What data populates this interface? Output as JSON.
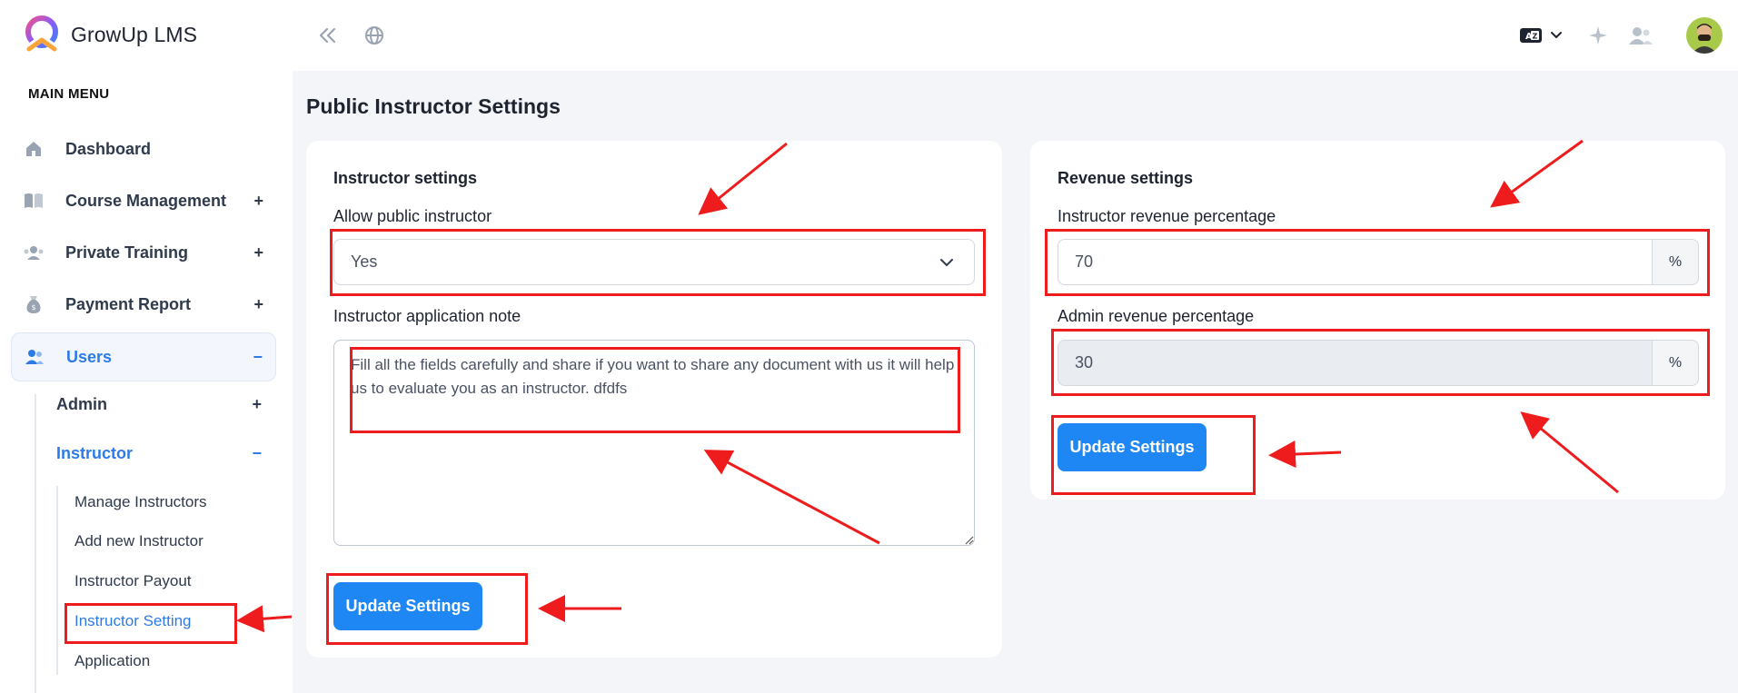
{
  "brand": {
    "name": "GrowUp LMS"
  },
  "sidebar": {
    "heading": "MAIN MENU",
    "items": [
      {
        "label": "Dashboard",
        "icon": "home-icon",
        "toggle": ""
      },
      {
        "label": "Course Management",
        "icon": "book-icon",
        "toggle": "+"
      },
      {
        "label": "Private Training",
        "icon": "training-icon",
        "toggle": "+"
      },
      {
        "label": "Payment Report",
        "icon": "money-bag-icon",
        "toggle": "+"
      },
      {
        "label": "Users",
        "icon": "users-icon",
        "toggle": "−"
      }
    ],
    "users_sub": [
      {
        "label": "Admin",
        "toggle": "+"
      },
      {
        "label": "Instructor",
        "toggle": "−"
      }
    ],
    "instructor_sub": [
      "Manage Instructors",
      "Add new Instructor",
      "Instructor Payout",
      "Instructor Setting",
      "Application"
    ]
  },
  "page": {
    "title": "Public Instructor Settings"
  },
  "instructor_card": {
    "title": "Instructor settings",
    "allow_label": "Allow public instructor",
    "allow_value": "Yes",
    "note_label": "Instructor application note",
    "note_value": "Fill all the fields carefully and share if you want to share any document with us it will help us to evaluate you as an instructor. dfdfs",
    "button": "Update Settings"
  },
  "revenue_card": {
    "title": "Revenue settings",
    "instructor_label": "Instructor revenue percentage",
    "instructor_value": "70",
    "admin_label": "Admin revenue percentage",
    "admin_value": "30",
    "suffix": "%",
    "button": "Update Settings"
  },
  "colors": {
    "accent": "#1f87f4",
    "annotation": "#ee1c1c",
    "active_nav": "#2d7be6"
  }
}
